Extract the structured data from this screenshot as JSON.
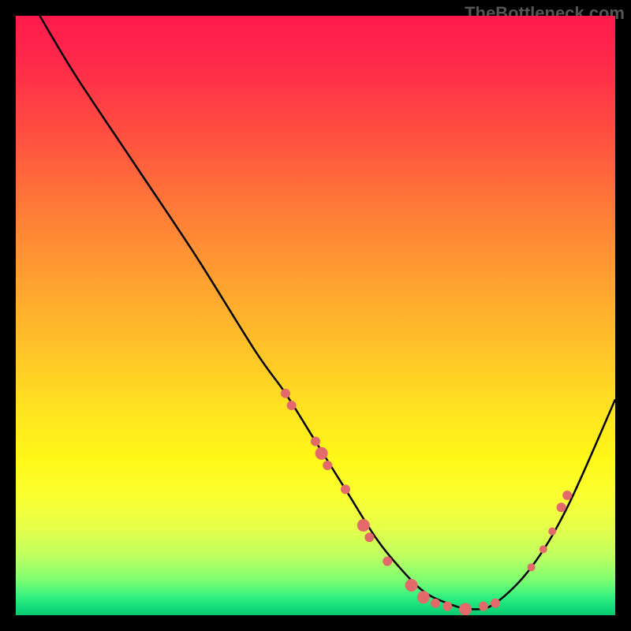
{
  "watermark": "TheBottleneck.com",
  "chart_data": {
    "type": "line",
    "title": "",
    "xlabel": "",
    "ylabel": "",
    "xlim": [
      0,
      100
    ],
    "ylim": [
      0,
      100
    ],
    "gradient_stops": [
      {
        "pos": 0,
        "color": "#ff1a4d"
      },
      {
        "pos": 20,
        "color": "#ff5040"
      },
      {
        "pos": 44,
        "color": "#ffa030"
      },
      {
        "pos": 66,
        "color": "#ffe420"
      },
      {
        "pos": 85,
        "color": "#e8ff48"
      },
      {
        "pos": 97,
        "color": "#30f080"
      },
      {
        "pos": 100,
        "color": "#0cc870"
      }
    ],
    "series": [
      {
        "name": "curve",
        "x": [
          4,
          10,
          20,
          30,
          40,
          45,
          50,
          55,
          60,
          64,
          68,
          72,
          76,
          80,
          86,
          92,
          100
        ],
        "y": [
          100,
          90,
          75,
          60,
          44,
          37,
          29,
          21,
          13,
          8,
          4,
          2,
          1,
          2,
          8,
          18,
          36
        ]
      }
    ],
    "markers": {
      "color": "#e36a6a",
      "points": [
        {
          "x": 45,
          "y": 37,
          "r": 6
        },
        {
          "x": 46,
          "y": 35,
          "r": 6
        },
        {
          "x": 50,
          "y": 29,
          "r": 6
        },
        {
          "x": 51,
          "y": 27,
          "r": 8
        },
        {
          "x": 52,
          "y": 25,
          "r": 6
        },
        {
          "x": 55,
          "y": 21,
          "r": 6
        },
        {
          "x": 58,
          "y": 15,
          "r": 8
        },
        {
          "x": 59,
          "y": 13,
          "r": 6
        },
        {
          "x": 62,
          "y": 9,
          "r": 6
        },
        {
          "x": 66,
          "y": 5,
          "r": 8
        },
        {
          "x": 68,
          "y": 3,
          "r": 8
        },
        {
          "x": 70,
          "y": 2,
          "r": 6
        },
        {
          "x": 72,
          "y": 1.5,
          "r": 6
        },
        {
          "x": 75,
          "y": 1,
          "r": 8
        },
        {
          "x": 78,
          "y": 1.5,
          "r": 6
        },
        {
          "x": 80,
          "y": 2,
          "r": 6
        },
        {
          "x": 86,
          "y": 8,
          "r": 5
        },
        {
          "x": 88,
          "y": 11,
          "r": 5
        },
        {
          "x": 89.5,
          "y": 14,
          "r": 5
        },
        {
          "x": 91,
          "y": 18,
          "r": 6
        },
        {
          "x": 92,
          "y": 20,
          "r": 6
        }
      ]
    }
  }
}
